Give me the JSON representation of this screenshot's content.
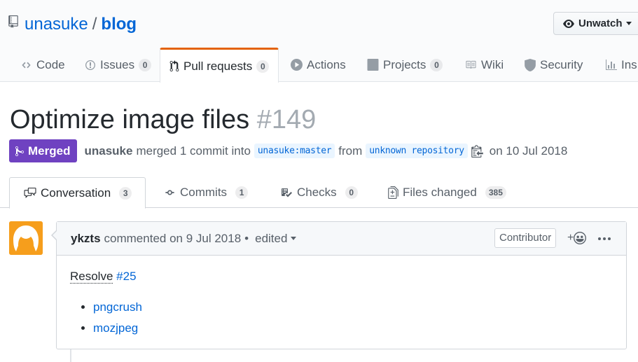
{
  "repo": {
    "owner": "unasuke",
    "slash": "/",
    "name": "blog",
    "unwatch_label": "Unwatch"
  },
  "reponav": {
    "code": "Code",
    "issues": {
      "label": "Issues",
      "count": "0"
    },
    "pull_requests": {
      "label": "Pull requests",
      "count": "0"
    },
    "actions": "Actions",
    "projects": {
      "label": "Projects",
      "count": "0"
    },
    "wiki": "Wiki",
    "security": "Security",
    "insights": "Ins"
  },
  "pr": {
    "title": "Optimize image files",
    "number": "#149",
    "state": "Merged",
    "author": "unasuke",
    "merged_text": "merged 1 commit into",
    "base_ref": "unasuke:master",
    "from_text": "from",
    "head_ref": "unknown repository",
    "date_text": "on 10 Jul 2018"
  },
  "tabs": {
    "conversation": {
      "label": "Conversation",
      "count": "3"
    },
    "commits": {
      "label": "Commits",
      "count": "1"
    },
    "checks": {
      "label": "Checks",
      "count": "0"
    },
    "files_changed": {
      "label": "Files changed",
      "count": "385"
    }
  },
  "comment": {
    "author": "ykzts",
    "commented_text": "commented on 9 Jul 2018",
    "separator": "•",
    "edited": "edited",
    "badge": "Contributor",
    "react_plus": "+",
    "body": {
      "resolve_word": "Resolve",
      "issue_ref": "#25",
      "items": [
        "pngcrush",
        "mozjpeg"
      ]
    }
  },
  "colors": {
    "merged": "#6f42c1",
    "link": "#0366d6",
    "accent_tab": "#e36209",
    "avatar": "#f69e1c"
  },
  "icons": [
    "repo-icon",
    "eye-icon",
    "code-icon",
    "issue-icon",
    "pull-request-icon",
    "play-icon",
    "project-icon",
    "book-icon",
    "shield-icon",
    "graph-icon",
    "merge-icon",
    "clippy-icon",
    "comment-discussion-icon",
    "commit-icon",
    "checklist-icon",
    "diff-icon",
    "smiley-icon",
    "kebab-horizontal-icon"
  ]
}
